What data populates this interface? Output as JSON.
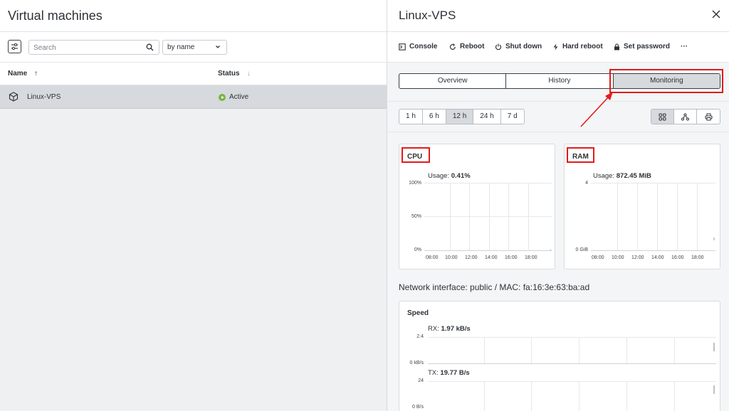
{
  "left": {
    "title": "Virtual machines",
    "search_placeholder": "Search",
    "sort_value": "by name",
    "columns": {
      "name": "Name",
      "name_sort": "↑",
      "status": "Status",
      "status_sort": "↓"
    },
    "rows": [
      {
        "name": "Linux-VPS",
        "status": "Active"
      }
    ]
  },
  "panel": {
    "title": "Linux-VPS",
    "actions": {
      "console": "Console",
      "reboot": "Reboot",
      "shutdown": "Shut down",
      "hard_reboot": "Hard reboot",
      "set_password": "Set password",
      "more": "···"
    },
    "tabs": [
      "Overview",
      "History",
      "Monitoring"
    ],
    "active_tab": "Monitoring",
    "ranges": [
      "1 h",
      "6 h",
      "12 h",
      "24 h",
      "7 d"
    ],
    "active_range": "12 h",
    "cpu": {
      "title": "CPU",
      "usage_label": "Usage:",
      "usage_value": "0.41%",
      "yticks": [
        "100%",
        "50%",
        "0%"
      ],
      "xticks": [
        "08:00",
        "10:00",
        "12:00",
        "14:00",
        "16:00",
        "18:00"
      ]
    },
    "ram": {
      "title": "RAM",
      "usage_label": "Usage:",
      "usage_value": "872.45 MiB",
      "yticks": [
        "4",
        "0 GiB"
      ],
      "xticks": [
        "08:00",
        "10:00",
        "12:00",
        "14:00",
        "16:00",
        "18:00"
      ]
    },
    "network_title": "Network interface: public / MAC: fa:16:3e:63:ba:ad",
    "speed": {
      "title": "Speed",
      "rx_label": "RX:",
      "rx_value": "1.97 kB/s",
      "rx_yticks": [
        "2.4",
        "0 kB/s"
      ],
      "tx_label": "TX:",
      "tx_value": "19.77 B/s",
      "tx_yticks": [
        "24",
        "0 B/s"
      ]
    }
  },
  "colors": {
    "highlight": "#e31b1b",
    "active_status": "#7cb342"
  }
}
